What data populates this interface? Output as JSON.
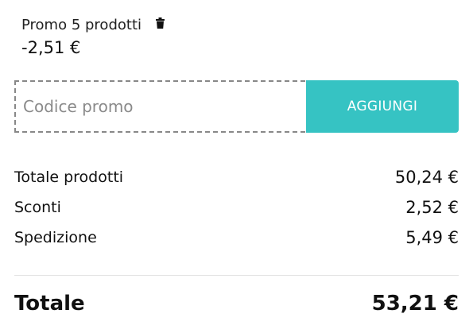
{
  "applied_promo": {
    "name": "Promo 5 prodotti",
    "amount": "-2,51 €",
    "remove_icon": "trash-icon"
  },
  "promo_code": {
    "placeholder": "Codice promo",
    "value": "",
    "add_label": "AGGIUNGI",
    "accent_color": "#36c3c3"
  },
  "summary": {
    "rows": [
      {
        "label": "Totale prodotti",
        "value": "50,24 €"
      },
      {
        "label": "Sconti",
        "value": "2,52 €"
      },
      {
        "label": "Spedizione",
        "value": "5,49 €"
      }
    ],
    "total": {
      "label": "Totale",
      "value": "53,21 €"
    }
  }
}
